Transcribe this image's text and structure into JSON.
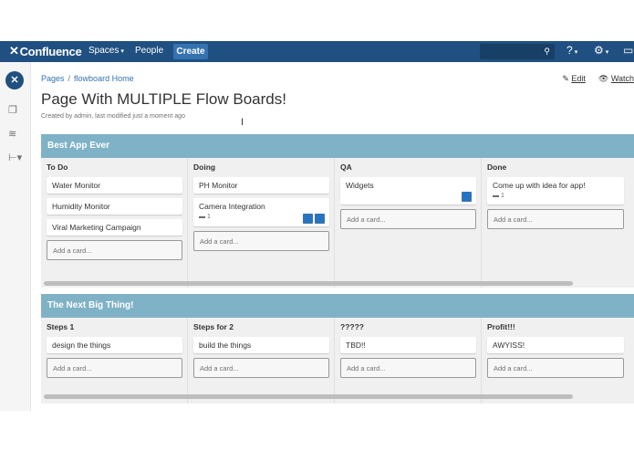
{
  "topbar": {
    "app_name": "Confluence",
    "spaces_label": "Spaces",
    "people_label": "People",
    "create_label": "Create"
  },
  "breadcrumb": {
    "items": [
      "Pages",
      "flowboard Home"
    ]
  },
  "page_actions": {
    "edit_label": "Edit",
    "watch_label": "Watch"
  },
  "page": {
    "title": "Page With MULTIPLE Flow Boards!",
    "byline": "Created by admin, last modified just a moment ago"
  },
  "boards": [
    {
      "name": "Best App Ever",
      "columns": [
        {
          "title": "To Do",
          "cards": [
            "Water Monitor",
            "Humidity Monitor",
            "Viral Marketing Campaign"
          ]
        },
        {
          "title": "Doing",
          "cards": [
            "PH Monitor",
            "Camera Integration"
          ],
          "camera_comment_count": "1"
        },
        {
          "title": "QA",
          "cards": [
            "Widgets"
          ]
        },
        {
          "title": "Done",
          "cards": [
            "Come up with idea for app!"
          ],
          "done_comment_count": "1"
        }
      ],
      "add_card_label": "Add a card..."
    },
    {
      "name": "The Next Big Thing!",
      "columns": [
        {
          "title": "Steps 1",
          "cards": [
            "design the things"
          ]
        },
        {
          "title": "Steps for 2",
          "cards": [
            "build the things"
          ]
        },
        {
          "title": "?????",
          "cards": [
            "TBD!!"
          ]
        },
        {
          "title": "Profit!!!",
          "cards": [
            "AWYISS!"
          ]
        }
      ],
      "add_card_label": "Add a card..."
    }
  ],
  "colors": {
    "navbar": "#205081",
    "board_header": "#7fb2c6",
    "avatar": "#3572b0"
  }
}
